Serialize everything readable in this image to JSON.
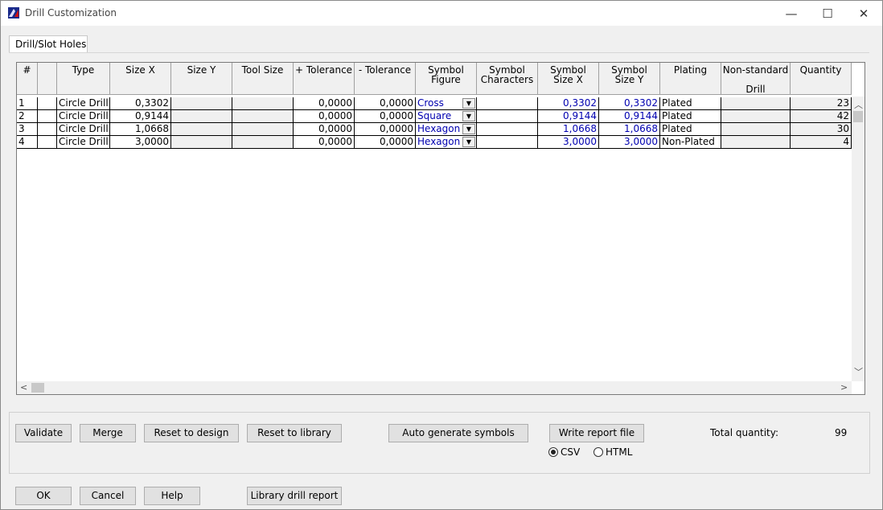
{
  "window": {
    "title": "Drill Customization",
    "minimize": "—",
    "maximize": "☐",
    "close": "✕"
  },
  "tab": {
    "label": "Drill/Slot Holes"
  },
  "table": {
    "headers": [
      {
        "line1": "#",
        "line2": "",
        "line3": ""
      },
      {
        "line1": "",
        "line2": "",
        "line3": ""
      },
      {
        "line1": "Type",
        "line2": "",
        "line3": ""
      },
      {
        "line1": "Size X",
        "line2": "",
        "line3": ""
      },
      {
        "line1": "Size Y",
        "line2": "",
        "line3": ""
      },
      {
        "line1": "Tool Size",
        "line2": "",
        "line3": ""
      },
      {
        "line1": "+ Tolerance",
        "line2": "",
        "line3": ""
      },
      {
        "line1": "- Tolerance",
        "line2": "",
        "line3": ""
      },
      {
        "line1": "Symbol",
        "line2": "Figure",
        "line3": ""
      },
      {
        "line1": "Symbol",
        "line2": "Characters",
        "line3": ""
      },
      {
        "line1": "Symbol",
        "line2": "Size X",
        "line3": ""
      },
      {
        "line1": "Symbol",
        "line2": "Size Y",
        "line3": ""
      },
      {
        "line1": "Plating",
        "line2": "",
        "line3": ""
      },
      {
        "line1": "Non-standard",
        "line2": "",
        "line3": "Drill"
      },
      {
        "line1": "Quantity",
        "line2": "",
        "line3": ""
      }
    ],
    "rows": [
      {
        "num": "1",
        "type": "Circle Drill",
        "size_x": "0,3302",
        "size_y": "",
        "tool_size": "",
        "plus_tol": "0,0000",
        "minus_tol": "0,0000",
        "figure": "Cross",
        "characters": "",
        "sym_x": "0,3302",
        "sym_y": "0,3302",
        "plating": "Plated",
        "nonstd": "",
        "qty": "23"
      },
      {
        "num": "2",
        "type": "Circle Drill",
        "size_x": "0,9144",
        "size_y": "",
        "tool_size": "",
        "plus_tol": "0,0000",
        "minus_tol": "0,0000",
        "figure": "Square",
        "characters": "",
        "sym_x": "0,9144",
        "sym_y": "0,9144",
        "plating": "Plated",
        "nonstd": "",
        "qty": "42"
      },
      {
        "num": "3",
        "type": "Circle Drill",
        "size_x": "1,0668",
        "size_y": "",
        "tool_size": "",
        "plus_tol": "0,0000",
        "minus_tol": "0,0000",
        "figure": "Hexagon",
        "characters": "",
        "sym_x": "1,0668",
        "sym_y": "1,0668",
        "plating": "Plated",
        "nonstd": "",
        "qty": "30"
      },
      {
        "num": "4",
        "type": "Circle Drill",
        "size_x": "3,0000",
        "size_y": "",
        "tool_size": "",
        "plus_tol": "0,0000",
        "minus_tol": "0,0000",
        "figure": "Hexagon",
        "characters": "",
        "sym_x": "3,0000",
        "sym_y": "3,0000",
        "plating": "Non-Plated",
        "nonstd": "",
        "qty": "4"
      }
    ]
  },
  "actions": {
    "validate": "Validate",
    "merge": "Merge",
    "reset_design": "Reset to design",
    "reset_library": "Reset to library",
    "auto_generate": "Auto generate symbols",
    "write_report": "Write report file",
    "csv": "CSV",
    "html": "HTML",
    "total_label": "Total quantity:",
    "total_value": "99"
  },
  "footer": {
    "ok": "OK",
    "cancel": "Cancel",
    "help": "Help",
    "library_report": "Library drill report"
  }
}
